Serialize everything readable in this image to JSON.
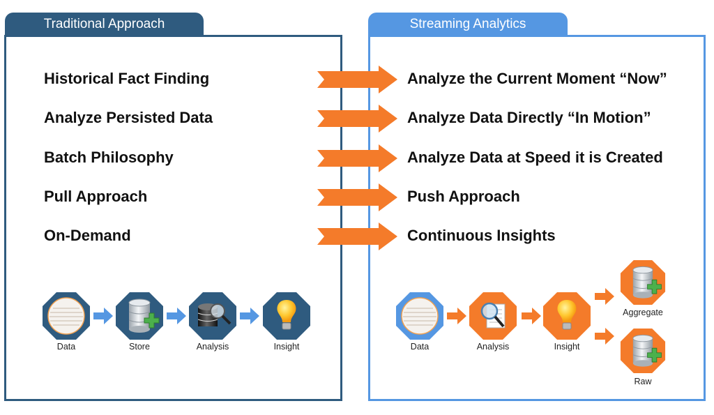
{
  "left_panel": {
    "title": "Traditional Approach",
    "color": "#2f5b7f",
    "items": [
      "Historical Fact Finding",
      "Analyze Persisted Data",
      "Batch Philosophy",
      "Pull Approach",
      "On-Demand"
    ],
    "flow": [
      {
        "label": "Data",
        "icon": "data-circle-icon"
      },
      {
        "label": "Store",
        "icon": "database-plus-icon"
      },
      {
        "label": "Analysis",
        "icon": "database-search-icon"
      },
      {
        "label": "Insight",
        "icon": "lightbulb-icon"
      }
    ]
  },
  "right_panel": {
    "title": "Streaming Analytics",
    "color": "#5597e2",
    "items": [
      "Analyze the Current Moment “Now”",
      "Analyze Data Directly “In Motion”",
      "Analyze Data at Speed it is Created",
      "Push Approach",
      "Continuous Insights"
    ],
    "flow": [
      {
        "label": "Data",
        "icon": "data-circle-icon"
      },
      {
        "label": "Analysis",
        "icon": "document-search-icon"
      },
      {
        "label": "Insight",
        "icon": "lightbulb-icon"
      },
      {
        "label": "Aggregate",
        "icon": "database-plus-icon"
      },
      {
        "label": "Raw",
        "icon": "database-plus-icon"
      }
    ]
  },
  "accent_orange": "#f47b2a"
}
